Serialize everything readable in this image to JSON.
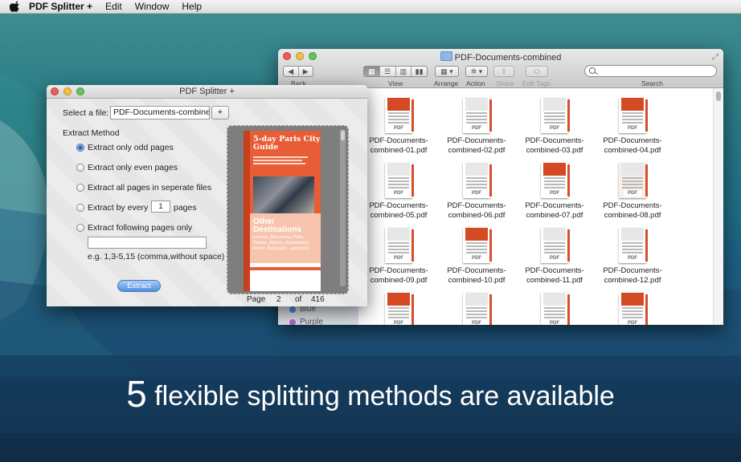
{
  "menubar": {
    "app_name": "PDF Splitter +",
    "items": [
      "Edit",
      "Window",
      "Help"
    ]
  },
  "finder": {
    "title": "PDF-Documents-combined",
    "toolbar": {
      "back_label": "Back",
      "view_label": "View",
      "arrange_label": "Arrange",
      "action_label": "Action",
      "share_label": "Share",
      "edit_tags_label": "Edit Tags",
      "search_label": "Search",
      "search_value": ""
    },
    "sidebar_tags": [
      {
        "label": "Blue",
        "color": "#4a8fe0"
      },
      {
        "label": "Purple",
        "color": "#b06ad2"
      }
    ],
    "files": [
      {
        "line1": "PDF-Documents-",
        "line2": "combined-01.pdf"
      },
      {
        "line1": "PDF-Documents-",
        "line2": "combined-02.pdf"
      },
      {
        "line1": "PDF-Documents-",
        "line2": "combined-03.pdf"
      },
      {
        "line1": "PDF-Documents-",
        "line2": "combined-04.pdf"
      },
      {
        "line1": "PDF-Documents-",
        "line2": "combined-05.pdf"
      },
      {
        "line1": "PDF-Documents-",
        "line2": "combined-06.pdf"
      },
      {
        "line1": "PDF-Documents-",
        "line2": "combined-07.pdf"
      },
      {
        "line1": "PDF-Documents-",
        "line2": "combined-08.pdf"
      },
      {
        "line1": "PDF-Documents-",
        "line2": "combined-09.pdf"
      },
      {
        "line1": "PDF-Documents-",
        "line2": "combined-10.pdf"
      },
      {
        "line1": "PDF-Documents-",
        "line2": "combined-11.pdf"
      },
      {
        "line1": "PDF-Documents-",
        "line2": "combined-12.pdf"
      },
      {
        "line1": "",
        "line2": ""
      },
      {
        "line1": "",
        "line2": ""
      },
      {
        "line1": "",
        "line2": ""
      },
      {
        "line1": "",
        "line2": ""
      }
    ],
    "pdf_badge": "PDF"
  },
  "splitter": {
    "title": "PDF Splitter +",
    "select_file_label": "Select a file:",
    "file_value": "PDF-Documents-combined",
    "add_button": "+",
    "extract_method_label": "Extract Method",
    "options": {
      "odd": "Extract only odd pages",
      "even": "Extract only even pages",
      "all": "Extract all pages in seperate files",
      "every_prefix": "Extract by every",
      "every_value": "1",
      "every_suffix": "pages",
      "following": "Extract following pages only",
      "following_value": "",
      "hint": "e.g. 1,3-5,15 (comma,without space)"
    },
    "selected_option": "odd",
    "extract_button": "Extract",
    "preview": {
      "heading": "5-day Paris City Guide",
      "subheading": "Other Destinations",
      "cities": "London, Barcelona, Paris, Boston, Athens, Amsterdam, Rome, Budapest ...and more"
    },
    "pager": {
      "page_label": "Page",
      "current": "2",
      "of_label": "of",
      "total": "416"
    }
  },
  "banner": {
    "number": "5",
    "text": "flexible splitting methods are available"
  }
}
